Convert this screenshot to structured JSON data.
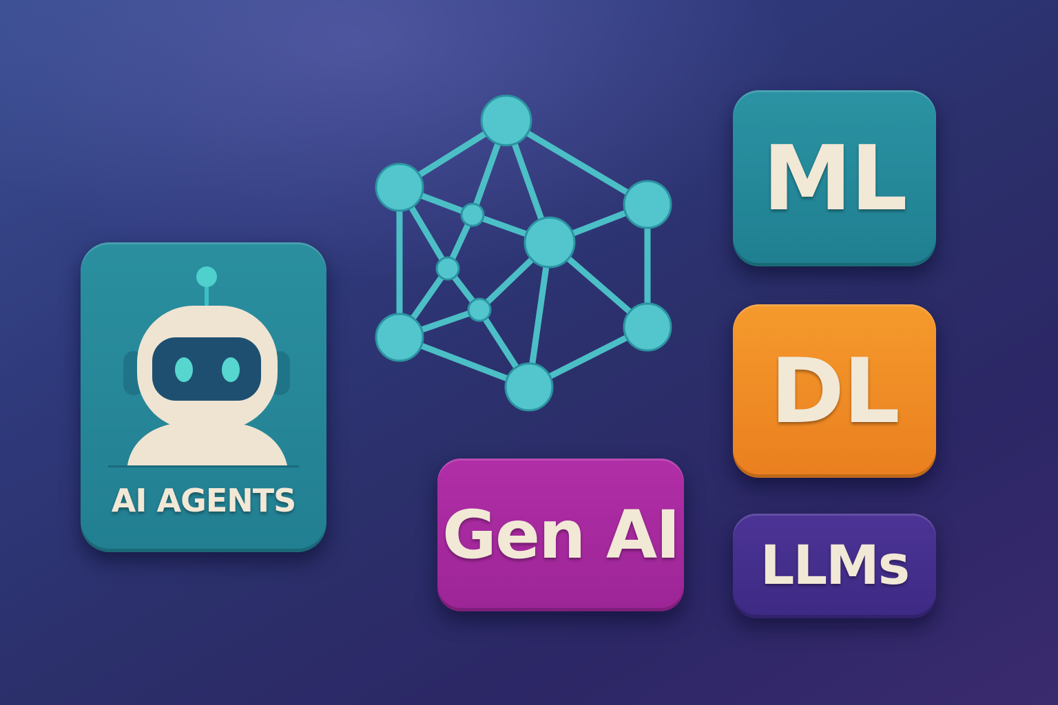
{
  "tiles": {
    "agents": "AI AGENTS",
    "ml": "ML",
    "dl": "DL",
    "gen_ai": "Gen AI",
    "llms": "LLMs"
  },
  "colors": {
    "teal": "#2a8f9f",
    "orange": "#f08c25",
    "magenta": "#a92aa0",
    "purple": "#47318f",
    "node": "#4cc2c9",
    "text": "#f2e8d6"
  },
  "icons": {
    "robot": "robot-icon",
    "network": "neural-network-icon"
  }
}
